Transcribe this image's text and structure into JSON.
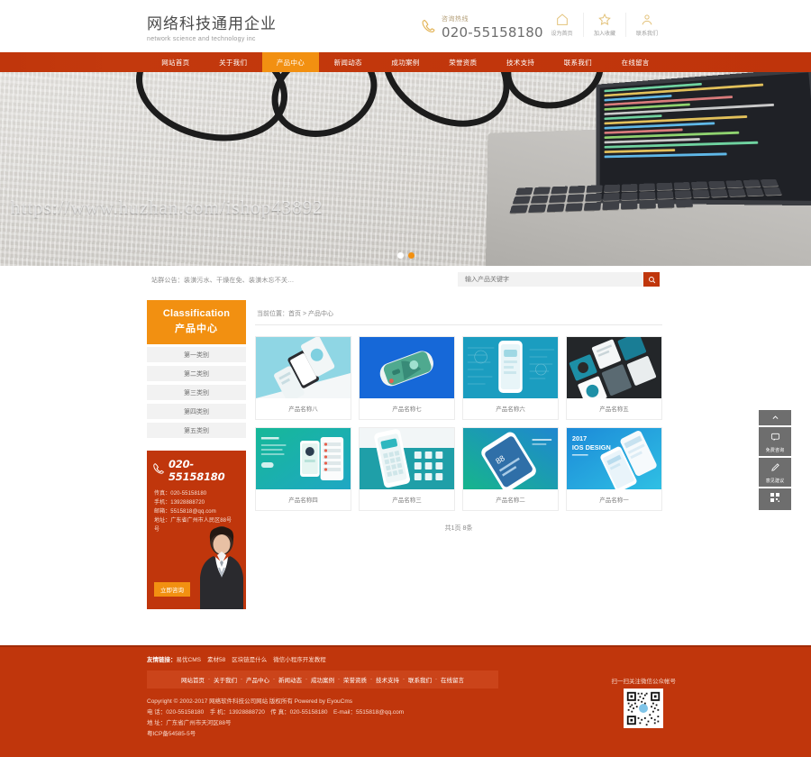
{
  "header": {
    "logo_cn": "网络科技通用企业",
    "logo_en": "network science and technology inc",
    "hotline_label": "咨询热线",
    "hotline_number": "020-55158180",
    "links": [
      {
        "label": "设为首页",
        "icon": "home-icon"
      },
      {
        "label": "加入收藏",
        "icon": "star-icon"
      },
      {
        "label": "联系我们",
        "icon": "contact-icon"
      }
    ]
  },
  "nav": {
    "items": [
      {
        "label": "网站首页",
        "active": false
      },
      {
        "label": "关于我们",
        "active": false
      },
      {
        "label": "产品中心",
        "active": true
      },
      {
        "label": "新闻动态",
        "active": false
      },
      {
        "label": "成功案例",
        "active": false
      },
      {
        "label": "荣誉资质",
        "active": false
      },
      {
        "label": "技术支持",
        "active": false
      },
      {
        "label": "联系我们",
        "active": false
      },
      {
        "label": "在线留言",
        "active": false
      }
    ]
  },
  "banner": {
    "watermark": "https://www.huzhan.com/ishop43892",
    "dots": 2,
    "active_dot": 2
  },
  "searchrow": {
    "notice": "站群公告：装潢污水、干燥在免、装潢木忘不关…",
    "search_placeholder": "输入产品关键字",
    "search_value": "",
    "search_icon": "search-icon"
  },
  "sidebar": {
    "classification_en": "Classification",
    "classification_cn": "产品中心",
    "categories": [
      {
        "label": "第一类别"
      },
      {
        "label": "第二类别"
      },
      {
        "label": "第三类别"
      },
      {
        "label": "第四类别"
      },
      {
        "label": "第五类别"
      }
    ],
    "contact": {
      "phone": "020-55158180",
      "fax_line": "传真：020-55158180",
      "mobile_line": "手机：13928888720",
      "email_line": "邮箱：5515818@qq.com",
      "address_line": "地址：广东省广州市人民区88号",
      "address_line2": "号",
      "button_label": "立即咨询"
    }
  },
  "content": {
    "breadcrumb_prefix": "当前位置：",
    "breadcrumb_home": "首页",
    "breadcrumb_sep": " > ",
    "breadcrumb_current": "产品中心",
    "products": [
      {
        "caption": "产品名称八",
        "c1": "#8fd6e4",
        "c2": "#f4f7f8",
        "style": "iso-light"
      },
      {
        "caption": "产品名称七",
        "c1": "#1668d8",
        "c2": "#2a8fd6",
        "style": "blue-phone"
      },
      {
        "caption": "产品名称六",
        "c1": "#1b9dc0",
        "c2": "#2db7cf",
        "style": "ui-dash"
      },
      {
        "caption": "产品名称五",
        "c1": "#2a2f33",
        "c2": "#1d2124",
        "style": "dark-grid"
      },
      {
        "caption": "产品名称四",
        "c1": "#13b08a",
        "c2": "#1ec6a4",
        "style": "green-app"
      },
      {
        "caption": "产品名称三",
        "c1": "#1f9fa8",
        "c2": "#27b3ba",
        "style": "calc-app"
      },
      {
        "caption": "产品名称二",
        "c1": "#1bb58c",
        "c2": "#1f8fd0",
        "style": "tilt-phone"
      },
      {
        "caption": "产品名称一",
        "c1": "#1c8ad8",
        "c2": "#27b9e0",
        "style": "ios-design"
      }
    ],
    "pager": "共1页 8条"
  },
  "floatbar": {
    "items": [
      {
        "label": "",
        "icon": "chevron-up-icon"
      },
      {
        "label": "免费咨询",
        "icon": "chat-icon"
      },
      {
        "label": "意见建议",
        "icon": "pencil-icon"
      },
      {
        "label": "微信二维码",
        "icon": "qr-icon"
      }
    ]
  },
  "footer": {
    "friendly_label": "友情链接：",
    "friendly_links": [
      "易优CMS",
      "素材58",
      "区块链是什么",
      "微信小程序开发教程"
    ],
    "nav": [
      "网站首页",
      "关于我们",
      "产品中心",
      "新闻动态",
      "成功案例",
      "荣誉资质",
      "技术支持",
      "联系我们",
      "在线留言"
    ],
    "copyright": "Copyright © 2002-2017 网络软件科技公司网站 版权所有 Powered by EyouCms",
    "contact_line": "电 话：020-55158180　手 机：13928888720　传 真：020-55158180　E-mail：5515818@qq.com",
    "address_line": "地 址：广东省广州市天河区88号",
    "icp_line": "粤ICP备54585-5号",
    "qr_label": "扫一扫关注微信公众帐号"
  },
  "colors": {
    "brand_red": "#c0360c",
    "brand_orange": "#f29011",
    "nav_active": "#f29011",
    "gray_panel": "#f2f2f2"
  }
}
